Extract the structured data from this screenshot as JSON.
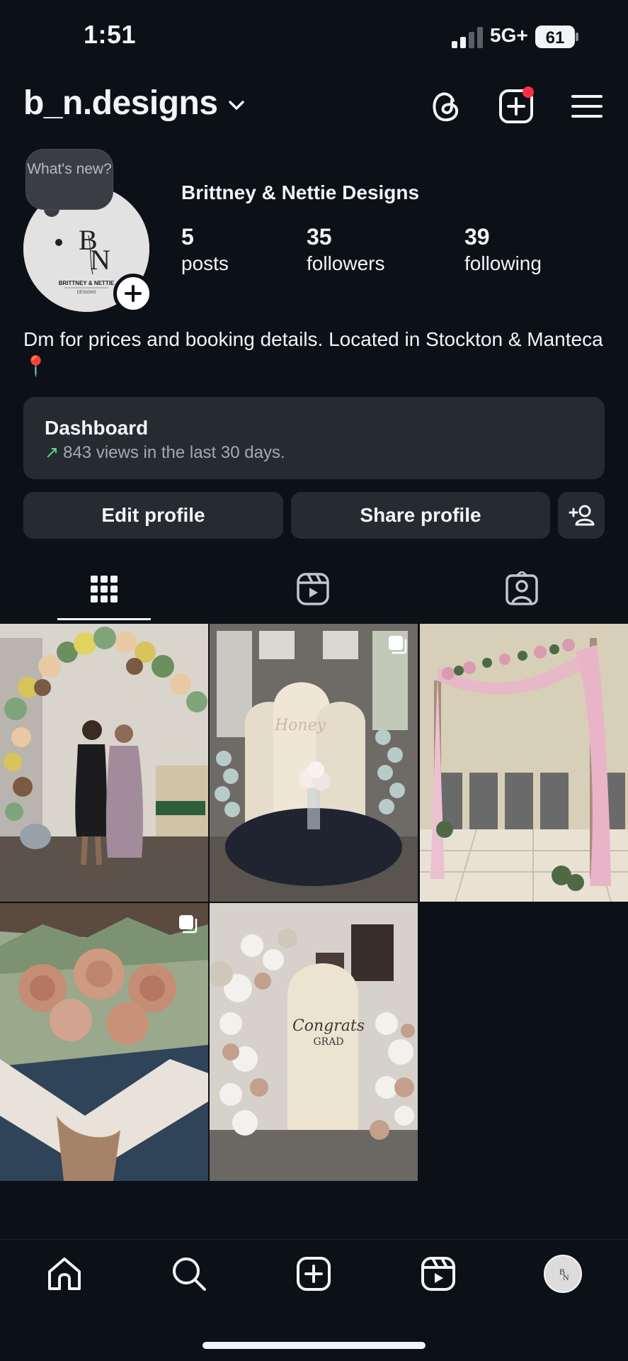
{
  "status_bar": {
    "time": "1:51",
    "network": "5G+",
    "battery": "61"
  },
  "header": {
    "username": "b_n.designs",
    "icons": [
      "threads-icon",
      "create-post-icon",
      "menu-icon"
    ],
    "notification_dot_color": "#ff3040"
  },
  "profile": {
    "bubble_text": "What's new?",
    "avatar_logo_monogram": "BN",
    "avatar_logo_text": "BRITTNEY & NETTIE",
    "avatar_logo_subtext": "DESIGNS",
    "full_name": "Brittney & Nettie Designs",
    "stats": [
      {
        "value": "5",
        "label": "posts"
      },
      {
        "value": "35",
        "label": "followers"
      },
      {
        "value": "39",
        "label": "following"
      }
    ],
    "bio": "Dm for prices and booking details. Located in Stockton & Manteca 📍"
  },
  "dashboard": {
    "title": "Dashboard",
    "subtitle": "843 views in the last 30 days.",
    "trend_color": "#5fd38d"
  },
  "buttons": {
    "edit": "Edit profile",
    "share": "Share profile"
  },
  "tabs": [
    {
      "name": "grid",
      "icon": "grid-icon",
      "active": true
    },
    {
      "name": "reels",
      "icon": "reels-icon",
      "active": false
    },
    {
      "name": "tagged",
      "icon": "tagged-icon",
      "active": false
    }
  ],
  "posts": [
    {
      "description": "balloon arch party",
      "multi": false,
      "overlay_text": ""
    },
    {
      "description": "honey theme table",
      "multi": true,
      "overlay_text": "Honey"
    },
    {
      "description": "pink drape arch",
      "multi": false,
      "overlay_text": ""
    },
    {
      "description": "money rose bouquet",
      "multi": true,
      "overlay_text": ""
    },
    {
      "description": "graduation backdrop",
      "multi": false,
      "overlay_text": "Congrats GRAD"
    }
  ],
  "bottom_nav": [
    "home-icon",
    "search-icon",
    "create-icon",
    "reels-icon",
    "profile-avatar"
  ]
}
